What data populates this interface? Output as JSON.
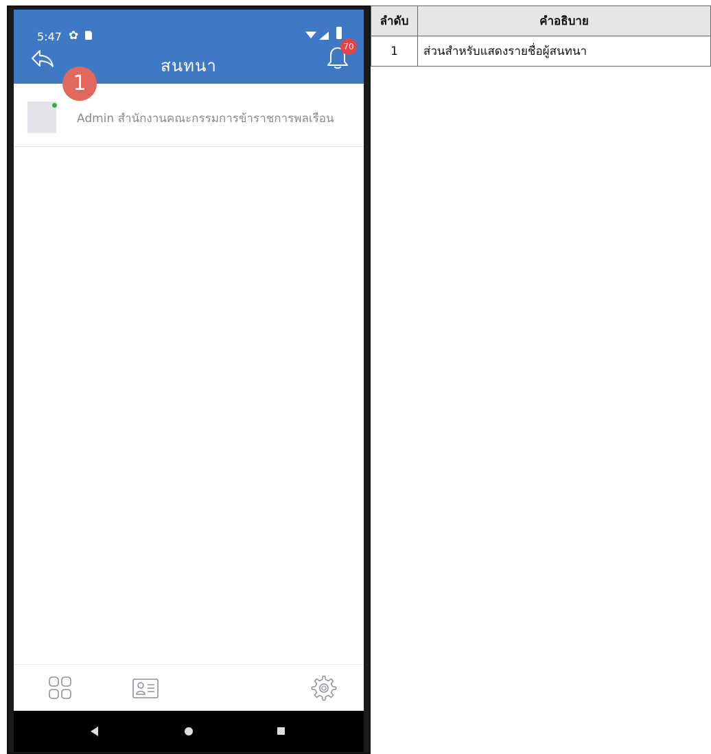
{
  "status_bar": {
    "time": "5:47"
  },
  "header": {
    "title": "สนทนา",
    "notification_count": "70"
  },
  "annotation": {
    "marker": "1"
  },
  "chat_list": [
    {
      "name": "Admin สำนักงานคณะกรรมการข้าราชการพลเรือน",
      "online": true
    }
  ],
  "tabbar": {
    "icons": [
      "apps-grid-icon",
      "contact-card-icon",
      "settings-gear-icon"
    ]
  },
  "navbar": {
    "icons": [
      "back-triangle-icon",
      "home-circle-icon",
      "recents-square-icon"
    ]
  },
  "desc_table": {
    "headers": [
      "ลำดับ",
      "คำอธิบาย"
    ],
    "rows": [
      {
        "num": "1",
        "desc": "ส่วนสำหรับแสดงรายชื่อผู้สนทนา"
      }
    ]
  },
  "colors": {
    "header_blue": "#3f79c6",
    "badge_red": "#e04545",
    "marker_red": "#e0685f",
    "online_green": "#3fa84a"
  }
}
